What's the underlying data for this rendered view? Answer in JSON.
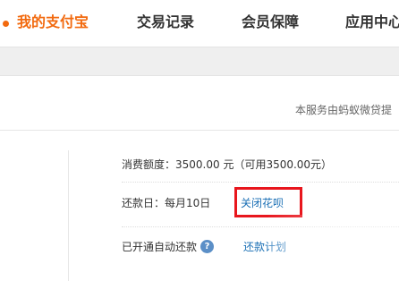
{
  "nav": {
    "items": [
      {
        "label": "我的支付宝",
        "active": true
      },
      {
        "label": "交易记录",
        "active": false
      },
      {
        "label": "会员保障",
        "active": false
      },
      {
        "label": "应用中心",
        "active": false
      }
    ]
  },
  "notice": {
    "text": "本服务由蚂蚁微贷提"
  },
  "account": {
    "credit_label": "消费额度：3500.00 元（可用3500.00元）",
    "repay_label": "还款日：每月10日",
    "close_link": "关闭花呗",
    "auto_repay_label": "已开通自动还款",
    "help_icon": "?",
    "plan_link": "还款计划"
  },
  "colors": {
    "accent": "#f26a0f",
    "link": "#1a6fb5",
    "highlight_box": "#e8161d"
  }
}
